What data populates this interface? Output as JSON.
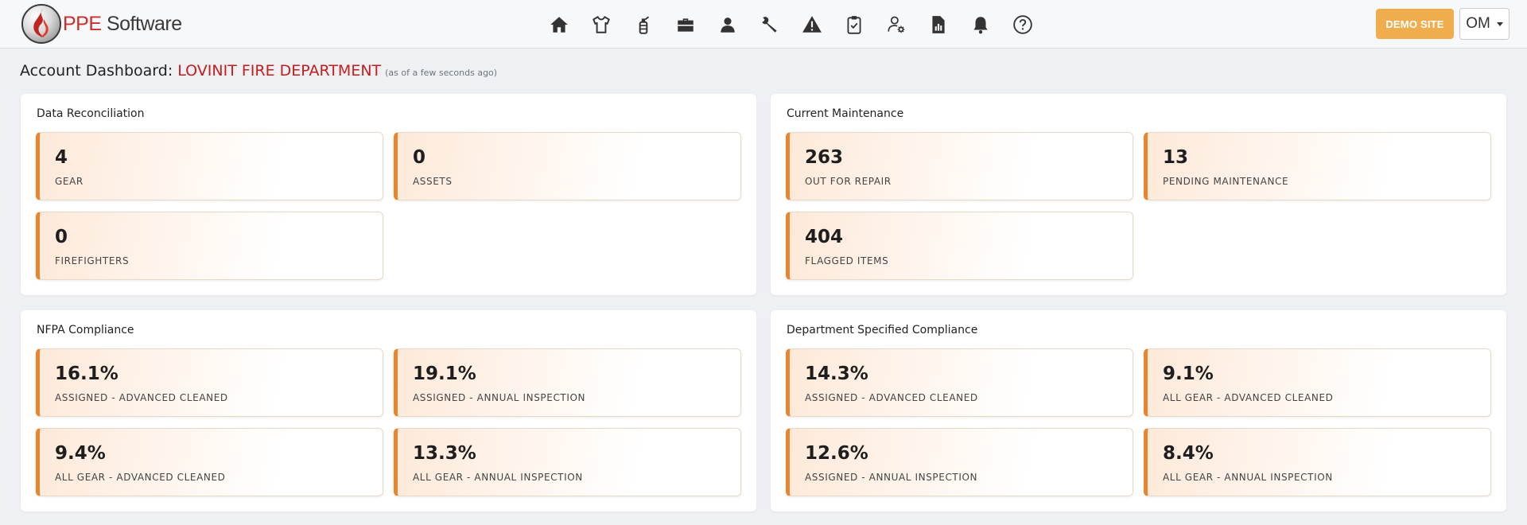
{
  "brand": {
    "ppe": "PPE",
    "software": " Software"
  },
  "nav_icons": [
    {
      "name": "home-icon",
      "color": "#333"
    },
    {
      "name": "shirt-icon",
      "color": "#333"
    },
    {
      "name": "extinguisher-icon",
      "color": "#333"
    },
    {
      "name": "briefcase-icon",
      "color": "#333"
    },
    {
      "name": "user-icon",
      "color": "#333"
    },
    {
      "name": "wrench-icon",
      "color": "#333"
    },
    {
      "name": "warning-icon",
      "color": "#333"
    },
    {
      "name": "clipboard-check-icon",
      "color": "#333"
    },
    {
      "name": "user-settings-icon",
      "color": "#333"
    },
    {
      "name": "report-icon",
      "color": "#333"
    },
    {
      "name": "bell-icon",
      "color": "#333"
    },
    {
      "name": "help-icon",
      "color": "#333"
    }
  ],
  "header": {
    "demo_label": "DEMO SITE",
    "user_label": "OM"
  },
  "heading": {
    "label": "Account Dashboard:",
    "department": "LOVINIT FIRE DEPARTMENT",
    "as_of": "(as of a few seconds ago)"
  },
  "panels": {
    "data_reconciliation": {
      "title": "Data Reconciliation",
      "cards": [
        {
          "value": "4",
          "caption": "GEAR"
        },
        {
          "value": "0",
          "caption": "ASSETS"
        },
        {
          "value": "0",
          "caption": "FIREFIGHTERS"
        }
      ]
    },
    "current_maintenance": {
      "title": "Current Maintenance",
      "cards": [
        {
          "value": "263",
          "caption": "OUT FOR REPAIR"
        },
        {
          "value": "13",
          "caption": "PENDING MAINTENANCE"
        },
        {
          "value": "404",
          "caption": "FLAGGED ITEMS"
        }
      ]
    },
    "nfpa_compliance": {
      "title": "NFPA Compliance",
      "cards": [
        {
          "value": "16.1%",
          "caption": "ASSIGNED - ADVANCED CLEANED"
        },
        {
          "value": "19.1%",
          "caption": "ASSIGNED - ANNUAL INSPECTION"
        },
        {
          "value": "9.4%",
          "caption": "ALL GEAR - ADVANCED CLEANED"
        },
        {
          "value": "13.3%",
          "caption": "ALL GEAR - ANNUAL INSPECTION"
        }
      ]
    },
    "department_compliance": {
      "title": "Department Specified Compliance",
      "cards": [
        {
          "value": "14.3%",
          "caption": "ASSIGNED - ADVANCED CLEANED"
        },
        {
          "value": "9.1%",
          "caption": "ALL GEAR - ADVANCED CLEANED"
        },
        {
          "value": "12.6%",
          "caption": "ASSIGNED - ANNUAL INSPECTION"
        },
        {
          "value": "8.4%",
          "caption": "ALL GEAR - ANNUAL INSPECTION"
        }
      ]
    }
  },
  "colors": {
    "accent": "#e8862f",
    "department_red": "#c61d1d",
    "demo_orange": "#f0ad4e"
  }
}
